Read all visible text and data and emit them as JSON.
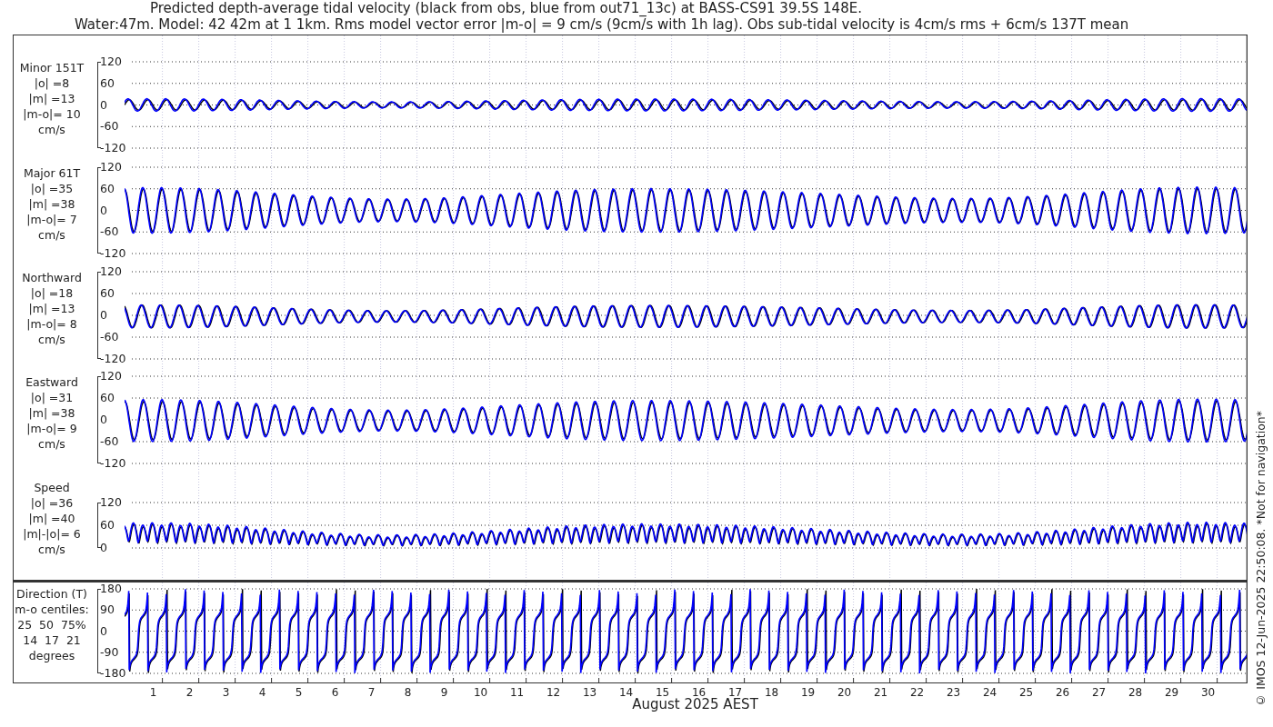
{
  "title_lines": [
    "Predicted depth-average tidal velocity (black from obs, blue from out71_13c) at BASS-CS91 39.5S 148E.",
    "Water:47m. Model: 42 42m at 1 1km. Rms model vector error |m-o| = 9 cm/s (9cm/s with 1h lag). Obs sub-tidal velocity is 4cm/s rms + 6cm/s 137T mean"
  ],
  "panels": [
    {
      "kind": "minor",
      "label_lines": [
        "Minor 151T",
        "|o| =8",
        "|m| =13",
        "|m-o|= 10",
        "cm/s"
      ],
      "yticks": [
        "120",
        "60",
        "0",
        "-60",
        "-120"
      ]
    },
    {
      "kind": "major",
      "label_lines": [
        "Major 61T",
        "|o| =35",
        "|m| =38",
        "|m-o|= 7",
        "cm/s"
      ],
      "yticks": [
        "120",
        "60",
        "0",
        "-60",
        "-120"
      ]
    },
    {
      "kind": "north",
      "label_lines": [
        "Northward",
        "|o| =18",
        "|m| =13",
        "|m-o|= 8",
        "cm/s"
      ],
      "yticks": [
        "120",
        "60",
        "0",
        "-60",
        "-120"
      ]
    },
    {
      "kind": "east",
      "label_lines": [
        "Eastward",
        "|o| =31",
        "|m| =38",
        "|m-o|= 9",
        "cm/s"
      ],
      "yticks": [
        "120",
        "60",
        "0",
        "-60",
        "-120"
      ]
    },
    {
      "kind": "speed",
      "label_lines": [
        "Speed",
        "|o| =36",
        "|m| =40",
        "|m|-|o|= 6",
        "cm/s"
      ],
      "yticks": [
        "120",
        "60",
        "0"
      ]
    }
  ],
  "direction_panel": {
    "kind": "direction",
    "label_lines": [
      "Direction (T)",
      "m-o centiles:",
      "25  50  75%",
      "14  17  21",
      "degrees"
    ],
    "yticks": [
      "180",
      "90",
      "0",
      "-90",
      "-180"
    ]
  },
  "xticks": [
    "1",
    "2",
    "3",
    "4",
    "5",
    "6",
    "7",
    "8",
    "9",
    "10",
    "11",
    "12",
    "13",
    "14",
    "15",
    "16",
    "17",
    "18",
    "19",
    "20",
    "21",
    "22",
    "23",
    "24",
    "25",
    "26",
    "27",
    "28",
    "29",
    "30"
  ],
  "xlabel": "August 2025 AEST",
  "credit": "© IMOS 12-Jun-2025 22:50:08. *Not for navigation*"
}
